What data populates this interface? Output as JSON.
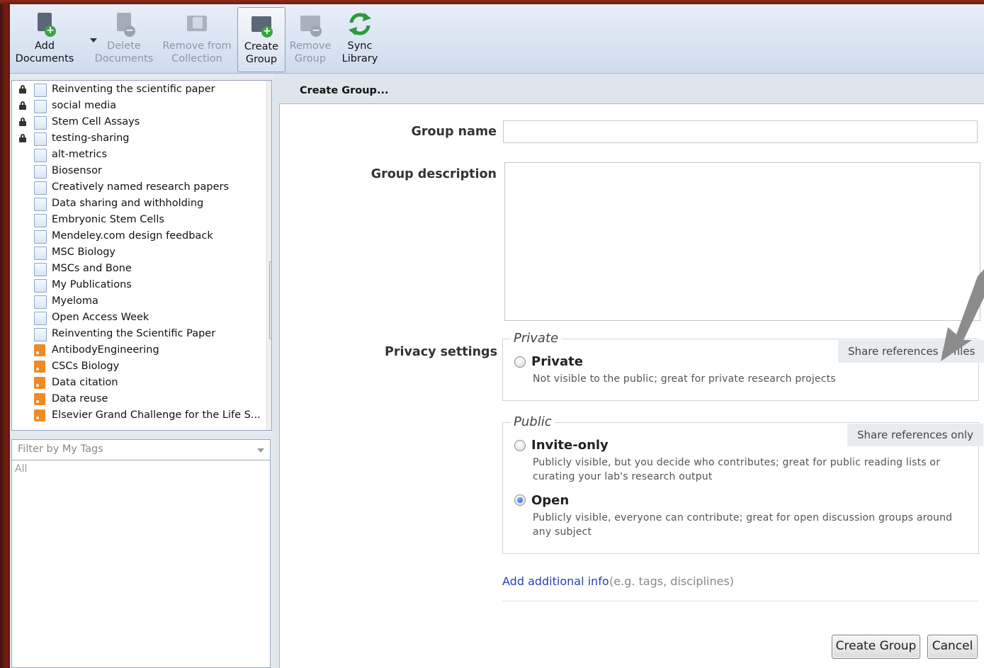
{
  "toolbar": {
    "buttons": [
      {
        "label1": "Add",
        "label2": "Documents",
        "icon": "add-document-icon",
        "enabled": true
      },
      {
        "label1": "Delete",
        "label2": "Documents",
        "icon": "delete-document-icon",
        "enabled": false
      },
      {
        "label1": "Remove from",
        "label2": "Collection",
        "icon": "remove-from-collection-icon",
        "enabled": false
      },
      {
        "label1": "Create",
        "label2": "Group",
        "icon": "create-group-icon",
        "enabled": true,
        "active": true
      },
      {
        "label1": "Remove",
        "label2": "Group",
        "icon": "remove-group-icon",
        "enabled": false
      },
      {
        "label1": "Sync",
        "label2": "Library",
        "icon": "sync-icon",
        "enabled": true
      }
    ]
  },
  "sidebar": {
    "collections": [
      {
        "label": "Reinventing the scientific paper",
        "locked": true,
        "type": "group"
      },
      {
        "label": "social media",
        "locked": true,
        "type": "group"
      },
      {
        "label": "Stem Cell Assays",
        "locked": true,
        "type": "group"
      },
      {
        "label": "testing-sharing",
        "locked": true,
        "type": "group"
      },
      {
        "label": "alt-metrics",
        "locked": false,
        "type": "group"
      },
      {
        "label": "Biosensor",
        "locked": false,
        "type": "group"
      },
      {
        "label": "Creatively named research papers",
        "locked": false,
        "type": "group"
      },
      {
        "label": "Data sharing and withholding",
        "locked": false,
        "type": "group"
      },
      {
        "label": "Embryonic Stem Cells",
        "locked": false,
        "type": "group"
      },
      {
        "label": "Mendeley.com design feedback",
        "locked": false,
        "type": "group"
      },
      {
        "label": "MSC Biology",
        "locked": false,
        "type": "group"
      },
      {
        "label": "MSCs and Bone",
        "locked": false,
        "type": "group"
      },
      {
        "label": "My Publications",
        "locked": false,
        "type": "group"
      },
      {
        "label": "Myeloma",
        "locked": false,
        "type": "group"
      },
      {
        "label": "Open Access Week",
        "locked": false,
        "type": "group"
      },
      {
        "label": "Reinventing the Scientific Paper",
        "locked": false,
        "type": "group"
      },
      {
        "label": "AntibodyEngineering",
        "locked": false,
        "type": "feed"
      },
      {
        "label": "CSCs Biology",
        "locked": false,
        "type": "feed"
      },
      {
        "label": "Data citation",
        "locked": false,
        "type": "feed"
      },
      {
        "label": "Data reuse",
        "locked": false,
        "type": "feed"
      },
      {
        "label": "Elsevier Grand Challenge for the Life S...",
        "locked": false,
        "type": "feed"
      }
    ],
    "tag_filter": {
      "label": "Filter by My Tags",
      "items": [
        "All"
      ]
    }
  },
  "panel": {
    "title": "Create Group...",
    "group_name_label": "Group name",
    "group_name_value": "",
    "group_description_label": "Group description",
    "group_description_value": "",
    "privacy_label": "Privacy settings",
    "private_section": {
      "legend": "Private",
      "share_note": "Share references & files",
      "options": [
        {
          "title": "Private",
          "desc": "Not visible to the public; great for private research projects",
          "checked": false
        }
      ]
    },
    "public_section": {
      "legend": "Public",
      "share_note": "Share references only",
      "options": [
        {
          "title": "Invite-only",
          "desc": "Publicly visible, but you decide who contributes; great for public reading lists or curating your lab's research output",
          "checked": false
        },
        {
          "title": "Open",
          "desc": "Publicly visible, everyone can contribute; great for open discussion groups around any subject",
          "checked": true
        }
      ]
    },
    "add_info_link": "Add additional info",
    "add_info_hint": "(e.g. tags, disciplines)",
    "create_button": "Create Group",
    "cancel_button": "Cancel"
  },
  "colors": {
    "window_frame": "#7a1c12",
    "toolbar_top": "#e7eef8",
    "toolbar_bottom": "#cfdcee",
    "link": "#2a3fb2",
    "feed_icon": "#f08a24",
    "sync_icon": "#2c9a3c"
  }
}
